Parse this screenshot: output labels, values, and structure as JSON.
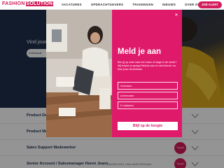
{
  "header": {
    "logo_part1": "FASHION",
    "logo_part2": "SOLUTION",
    "nav": [
      "VACATURES",
      "OPDRACHTGEVERS",
      "TRAININGEN",
      "NIEUWS",
      "OVER ONS"
    ],
    "cta_label": "JOB ALERT"
  },
  "hero": {
    "headline": "Vind jouw",
    "pill_text": "Zoekvacat"
  },
  "jobs": [
    {
      "title": "Product De",
      "location": "",
      "badge": ""
    },
    {
      "title": "Product Ma",
      "location": "",
      "badge": ""
    },
    {
      "title": "Sales Support Medewerker",
      "location": "",
      "badge": "Top job"
    },
    {
      "title": "Senior Account / Salesmanager Heren Jeans",
      "location": "OMGEVING VAN AMSTERDAM",
      "badge": "Top job"
    }
  ],
  "modal": {
    "title": "Meld je aan",
    "description": "Ben jij op zoek naar een baan of stage in de mode? Wij helpen je graag! Meld je aan en vind binnen no-time jouw droombaan.",
    "fields": {
      "first_name_placeholder": "Voornaam",
      "last_name_placeholder": "Achternaam",
      "email_placeholder": "E-mailadres"
    },
    "submit_label": "Blijf op de hoogte"
  },
  "colors": {
    "brand": "#d11d5b",
    "modal_bg": "#e01a6b",
    "hero_bg": "#1e2f4d"
  }
}
